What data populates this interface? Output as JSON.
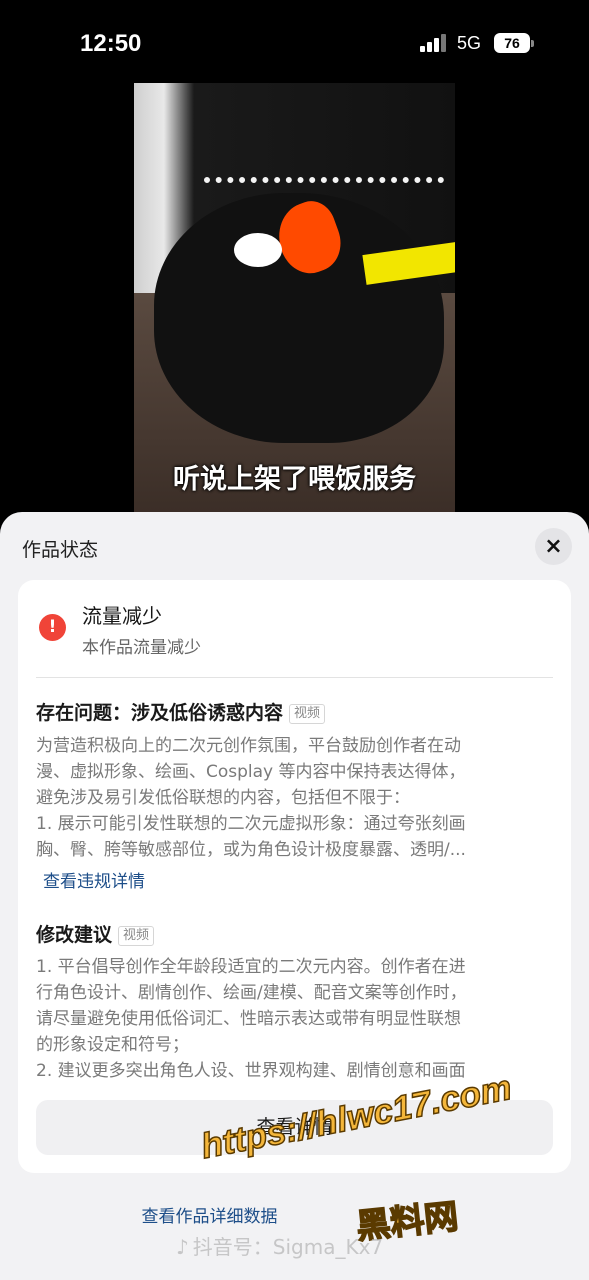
{
  "status_bar": {
    "time": "12:50",
    "network": "5G",
    "battery": "76"
  },
  "video": {
    "subtitle": "听说上架了喂饭服务"
  },
  "sheet": {
    "title": "作品状态",
    "close_icon": "×",
    "status": {
      "icon": "!",
      "title": "流量减少",
      "subtitle": "本作品流量减少"
    },
    "issue": {
      "title": "存在问题：涉及低俗诱惑内容",
      "tag": "视频",
      "lines": [
        "为营造积极向上的二次元创作氛围，平台鼓励创作者在动",
        "漫、虚拟形象、绘画、Cosplay 等内容中保持表达得体，",
        "避免涉及易引发低俗联想的内容，包括但不限于：",
        "1. 展示可能引发性联想的二次元虚拟形象：通过夸张刻画",
        "胸、臀、胯等敏感部位，或为角色设计极度暴露、透明/..."
      ],
      "link": "查看违规详情"
    },
    "suggestion": {
      "title": "修改建议",
      "tag": "视频",
      "lines": [
        "1. 平台倡导创作全年龄段适宜的二次元内容。创作者在进",
        "行角色设计、剧情创作、绘画/建模、配音文案等创作时，",
        "请尽量避免使用低俗词汇、性暗示表达或带有明显性联想",
        "的形象设定和符号；",
        "2. 建议更多突出角色人设、世界观构建、剧情创意和画面"
      ]
    },
    "detail_button": "查看详情",
    "bottom_link": "查看作品详细数据"
  },
  "watermarks": {
    "url": "https://hlwc17.com",
    "site_name": "黑料网",
    "douyin_id": "抖音号：Sigma_Kx7"
  }
}
